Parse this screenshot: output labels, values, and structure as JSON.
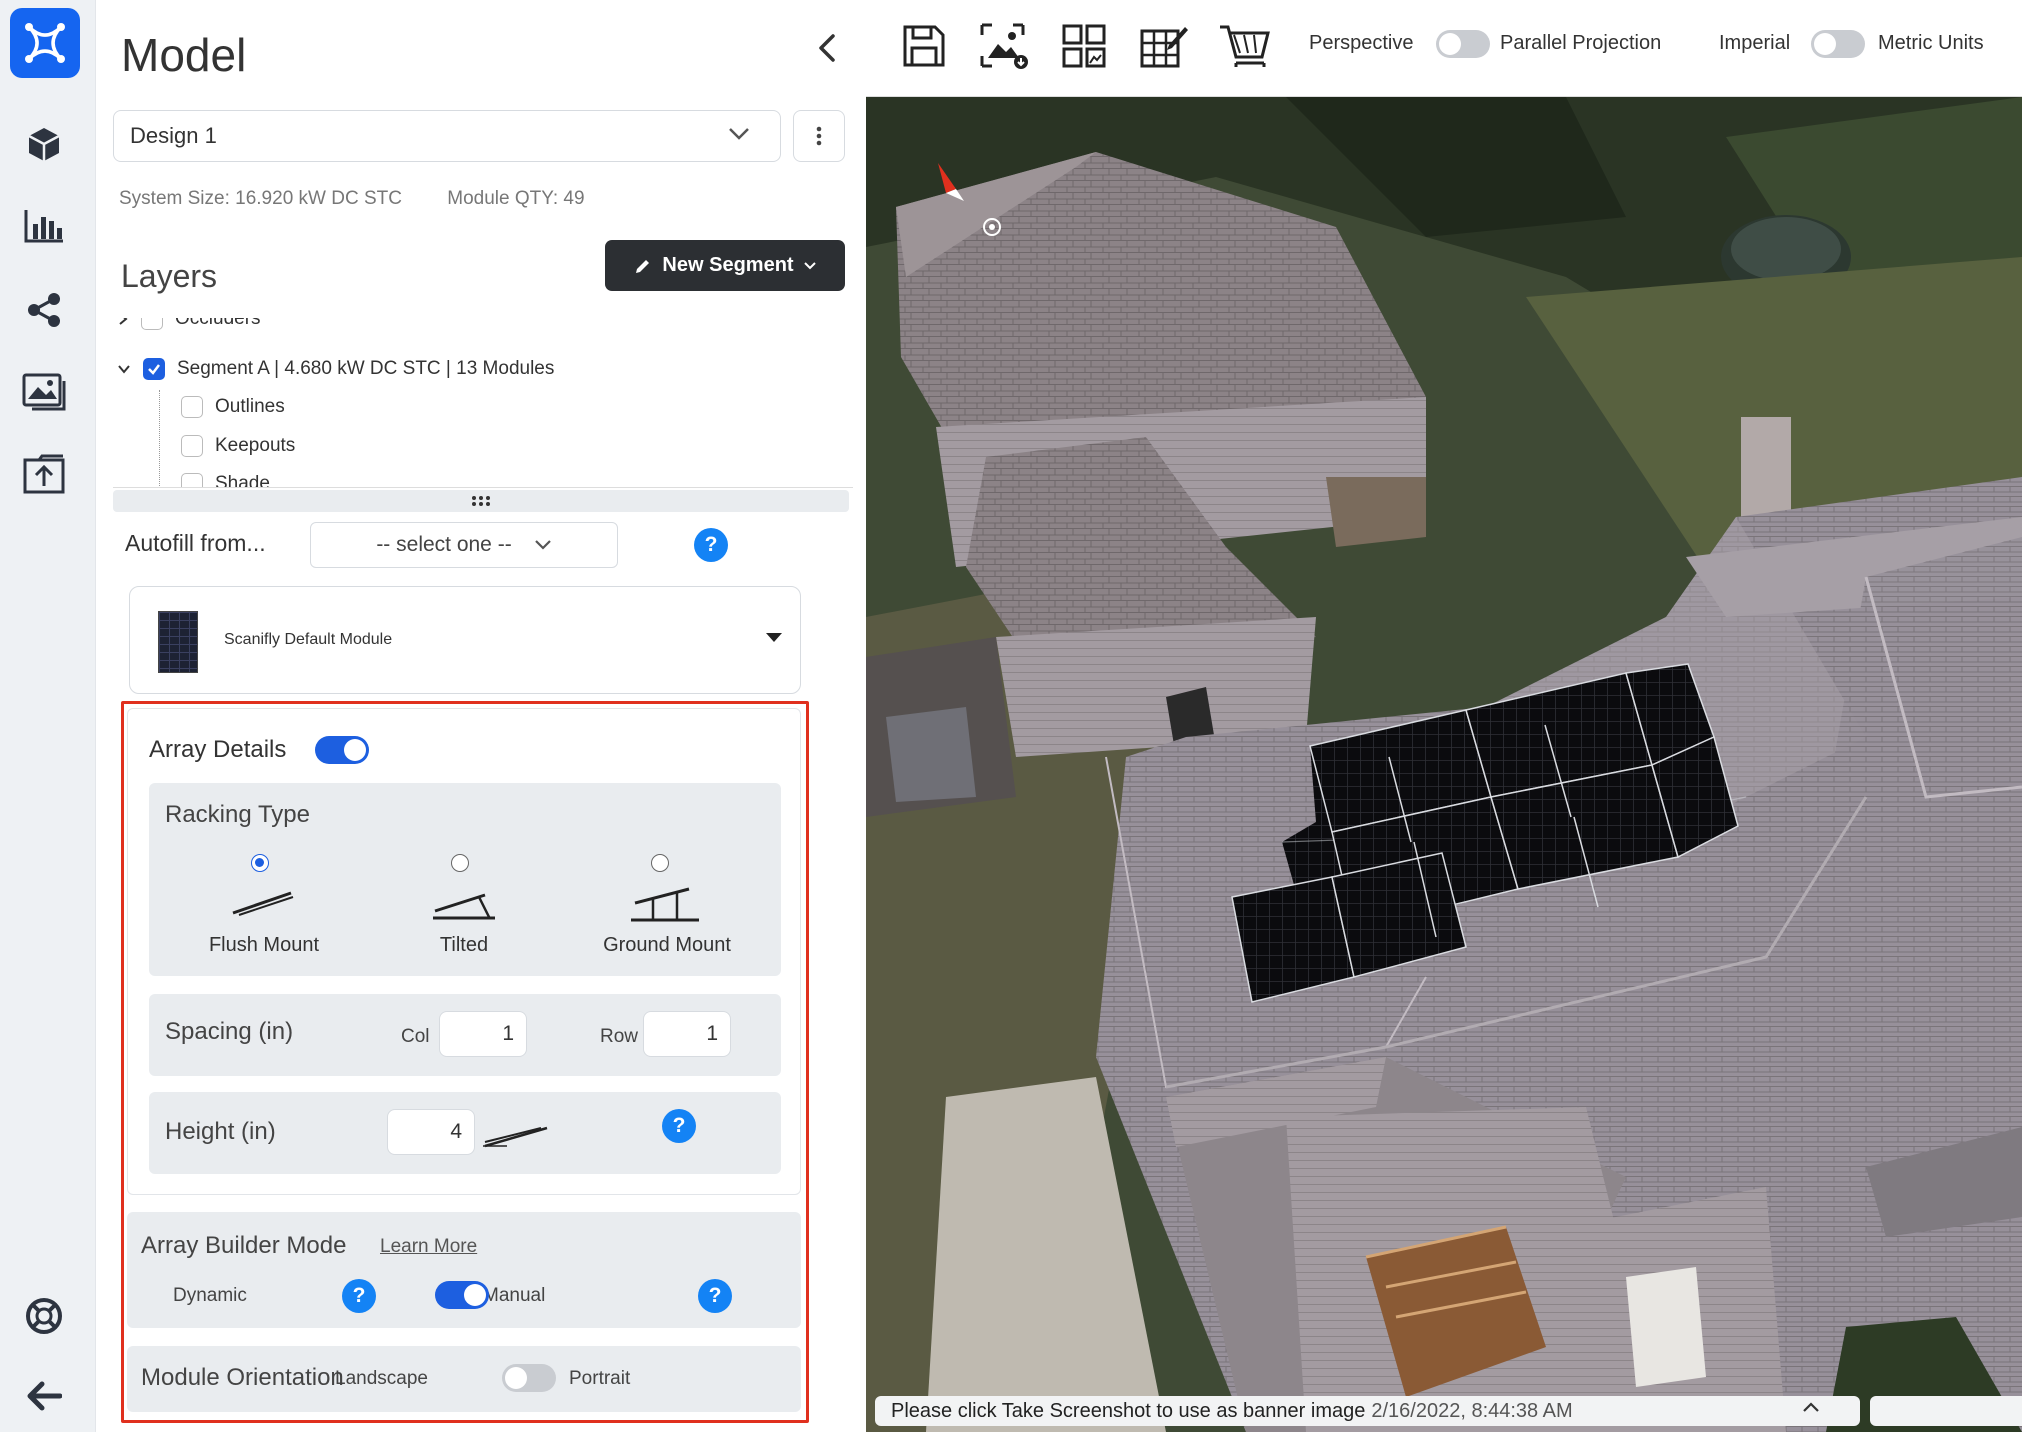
{
  "rail": {
    "icons": [
      "app-logo",
      "cube-icon",
      "bar-chart-icon",
      "share-icon",
      "images-icon",
      "upload-folder-icon",
      "help-lifebuoy-icon",
      "back-arrow-icon"
    ]
  },
  "panel": {
    "title": "Model",
    "design_select": {
      "value": "Design 1"
    },
    "system_size": "System Size: 16.920 kW DC STC",
    "module_qty": "Module QTY: 49",
    "layers_title": "Layers",
    "new_segment_label": "New Segment",
    "tree": [
      {
        "label": "Occluders",
        "checked": false,
        "level": 0,
        "expanded": false
      },
      {
        "label": "Segment A | 4.680 kW DC STC | 13 Modules",
        "checked": true,
        "level": 0,
        "expanded": true
      },
      {
        "label": "Outlines",
        "checked": false,
        "level": 1
      },
      {
        "label": "Keepouts",
        "checked": false,
        "level": 1
      },
      {
        "label": "Shade",
        "checked": false,
        "level": 1
      }
    ],
    "autofill": {
      "label": "Autofill from...",
      "value": "-- select one --"
    },
    "module": {
      "name": "Scanifly Default Module"
    },
    "array_details": {
      "label": "Array Details",
      "enabled": true,
      "racking": {
        "title": "Racking Type",
        "options": [
          {
            "label": "Flush Mount",
            "selected": true
          },
          {
            "label": "Tilted",
            "selected": false
          },
          {
            "label": "Ground Mount",
            "selected": false
          }
        ]
      },
      "spacing": {
        "title": "Spacing (in)",
        "col_label": "Col",
        "col_value": "1",
        "row_label": "Row",
        "row_value": "1"
      },
      "height": {
        "title": "Height (in)",
        "value": "4"
      }
    },
    "builder_mode": {
      "title": "Array Builder Mode",
      "learn_more": "Learn More",
      "dynamic_label": "Dynamic",
      "manual_label": "Manual",
      "manual": true
    },
    "orientation": {
      "title": "Module Orientation",
      "landscape_label": "Landscape",
      "portrait_label": "Portrait",
      "portrait": false
    }
  },
  "toolbar": {
    "icons": [
      "save-icon",
      "image-download-icon",
      "layout-grid-icon",
      "grid-edit-icon",
      "cart-frame-icon"
    ],
    "perspective_label": "Perspective",
    "parallel_label": "Parallel Projection",
    "projection_parallel": false,
    "imperial_label": "Imperial",
    "metric_label": "Metric Units",
    "units_metric": false
  },
  "status_bar": {
    "message": "Please click Take Screenshot to use as banner image",
    "timestamp": "2/16/2022, 8:44:38 AM"
  },
  "colors": {
    "accent": "#1d5fe0",
    "help": "#1483f5",
    "highlight": "#e0301e",
    "logo": "#1565f0"
  }
}
